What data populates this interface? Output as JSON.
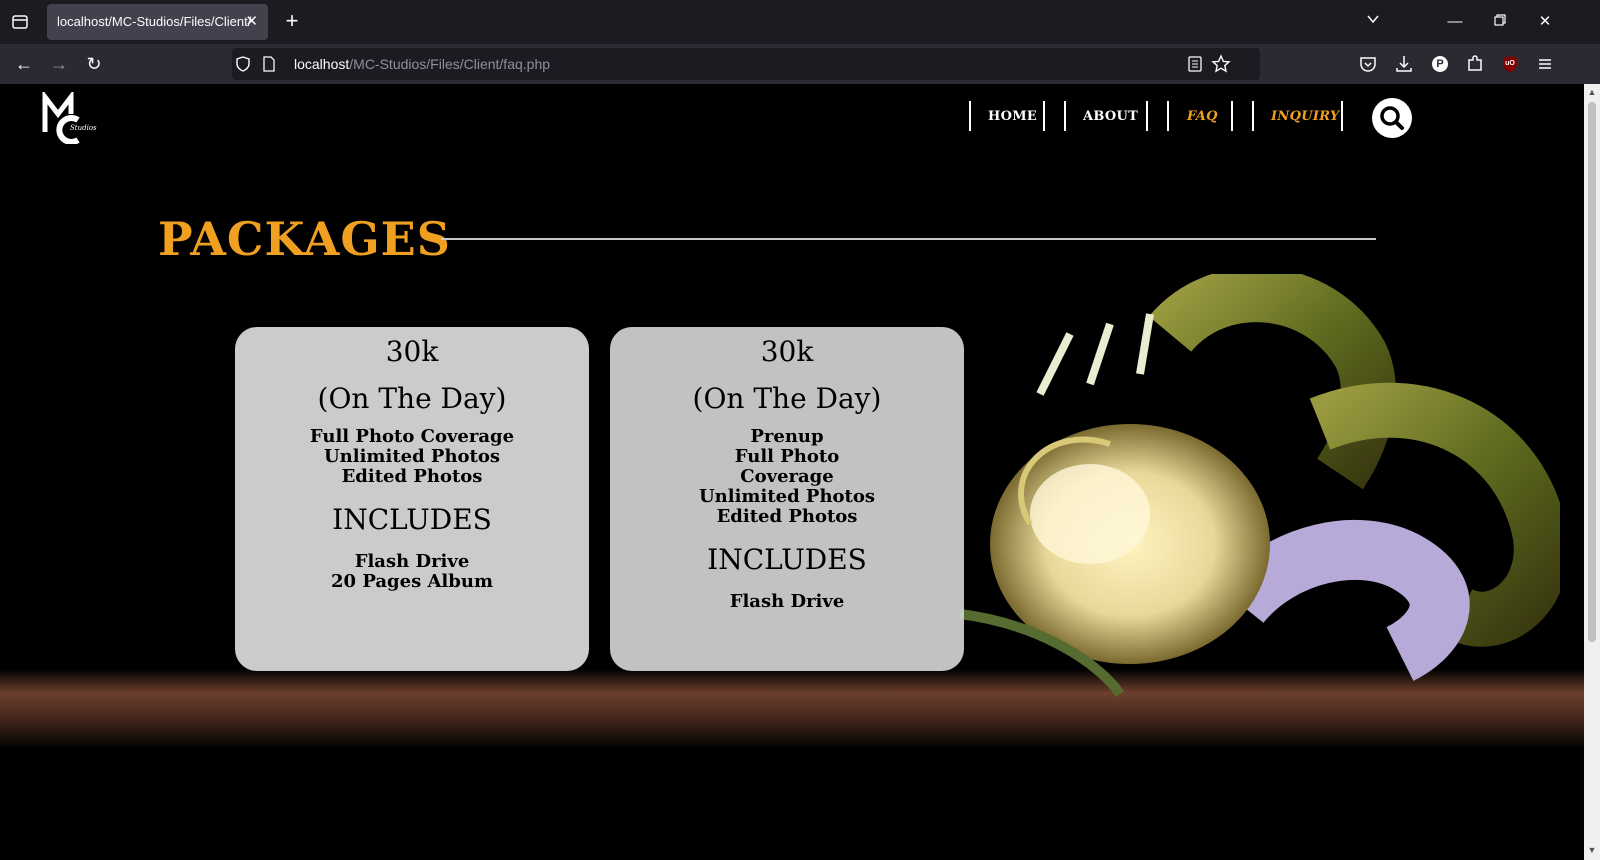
{
  "browser": {
    "tab_title": "localhost/MC-Studios/Files/Client/",
    "url_host": "localhost",
    "url_path": "/MC-Studios/Files/Client/faq.php",
    "extension_initial": "P",
    "extension_badge": "uO"
  },
  "site": {
    "logo_text": "Studios",
    "nav": [
      {
        "label": "HOME",
        "active": false
      },
      {
        "label": "ABOUT",
        "active": false
      },
      {
        "label": "FAQ",
        "active": true
      },
      {
        "label": "INQUIRY",
        "active": true
      }
    ],
    "accent_color": "#f0a020"
  },
  "section": {
    "title": "PACKAGES"
  },
  "packages": [
    {
      "price": "30k",
      "period": "(On The Day)",
      "features": [
        "Full Photo Coverage",
        "Unlimited Photos",
        "Edited Photos"
      ],
      "includes_label": "INCLUDES",
      "includes": [
        "Flash Drive",
        "20 Pages Album"
      ]
    },
    {
      "price": "30k",
      "period": "(On The Day)",
      "features": [
        "Prenup",
        "Full Photo",
        "Coverage",
        "Unlimited Photos",
        "Edited Photos"
      ],
      "includes_label": "INCLUDES",
      "includes": [
        "Flash Drive"
      ]
    }
  ]
}
